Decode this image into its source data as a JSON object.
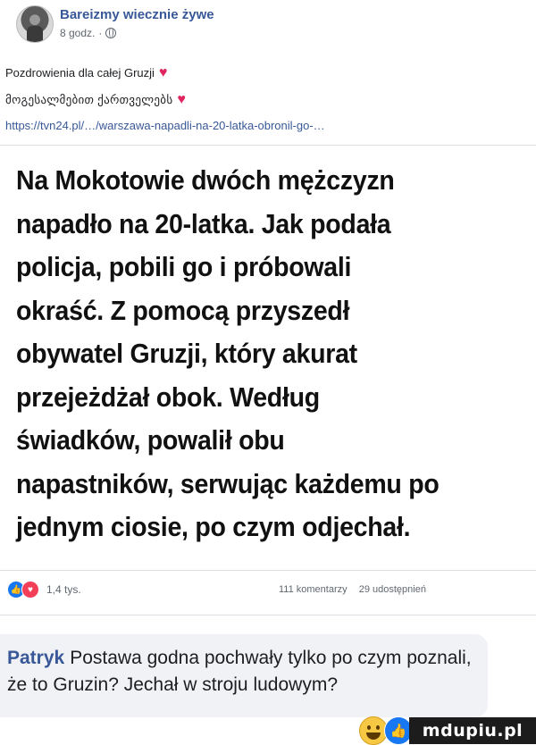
{
  "post": {
    "page_name": "Bareizmy wiecznie żywe",
    "time": "8 godz.",
    "separator": "·",
    "lines": [
      "Pozdrowienia dla całej Gruzji",
      "მოგესალმებით ქართველებს",
      "https://tvn24.pl/…/warszawa-napadli-na-20-latka-obronil-go-…"
    ],
    "heart_emoji": "♥"
  },
  "headline": {
    "lines": [
      "Na Mokotowie dwóch mężczyzn",
      "napadło na 20-latka. Jak podała",
      "policja, pobili go i próbowali",
      "okraść. Z pomocą przyszedł",
      "obywatel Gruzji, który akurat",
      "przejeżdżał obok. Według",
      "świadków, powalił obu",
      "napastników, serwując każdemu po",
      "jednym ciosie, po czym odjechał."
    ]
  },
  "stats": {
    "reaction_count": "1,4 tys.",
    "comments": "111 komentarzy",
    "shares": "29 udostępnień",
    "like_glyph": "👍",
    "love_glyph": "♥"
  },
  "comment": {
    "author": "Patryk",
    "text": "Postawa godna pochwały tylko po czym poznali, że to Gruzin? Jechał w stroju ludowym?"
  },
  "watermark": {
    "text": "mdupiu.pl"
  },
  "colors": {
    "link": "#385898",
    "like": "#1877f2",
    "love": "#f33e58",
    "comment_bg": "#f0f2f5"
  }
}
